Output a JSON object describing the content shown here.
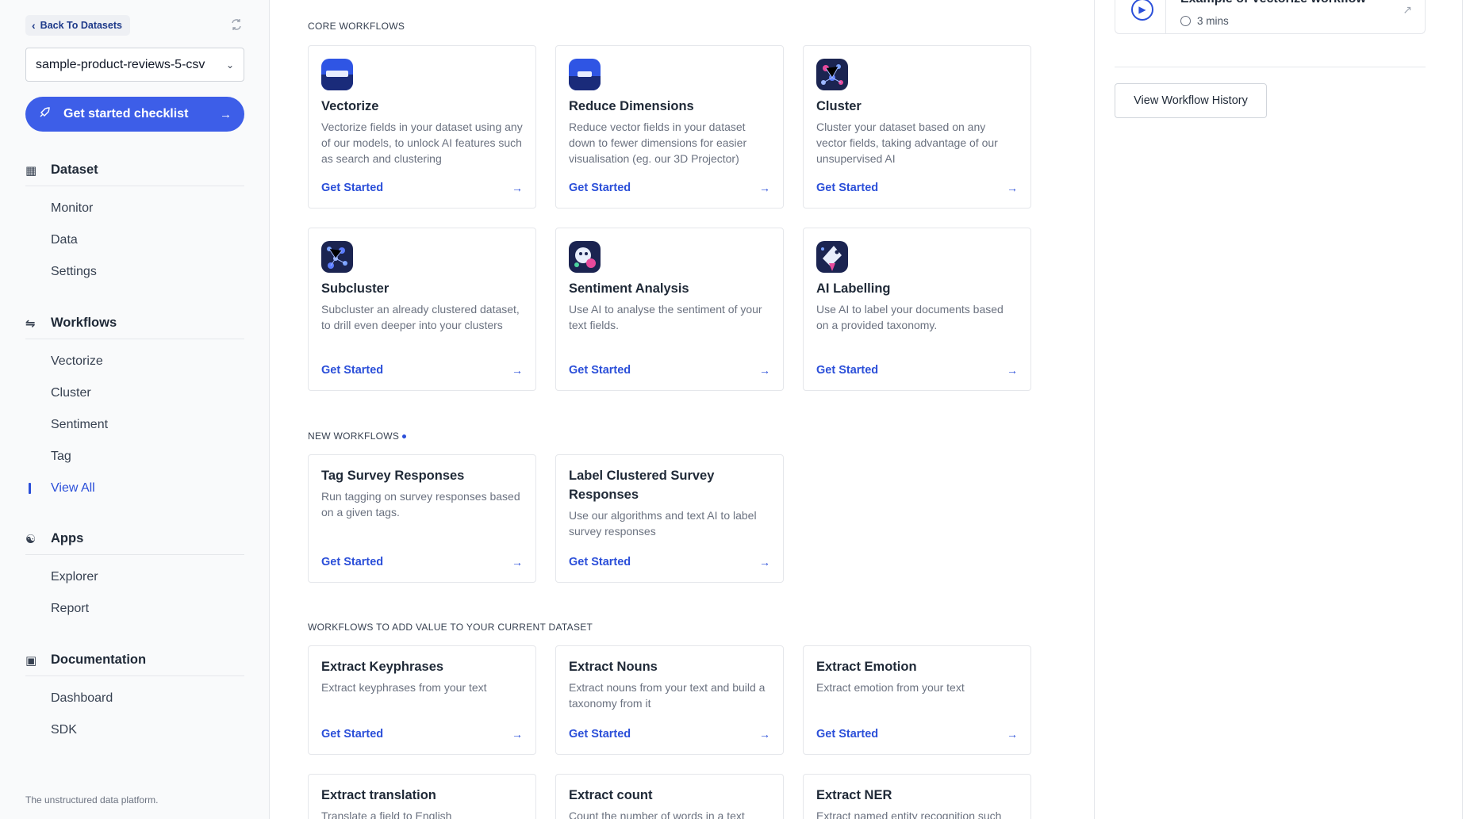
{
  "sidebar": {
    "back_label": "Back To Datasets",
    "dataset_name": "sample-product-reviews-5-csv",
    "checklist_label": "Get started checklist",
    "sections": [
      {
        "title": "Dataset",
        "icon": "table-icon",
        "items": [
          "Monitor",
          "Data",
          "Settings"
        ]
      },
      {
        "title": "Workflows",
        "icon": "workflow-icon",
        "items": [
          "Vectorize",
          "Cluster",
          "Sentiment",
          "Tag",
          "View All"
        ]
      },
      {
        "title": "Apps",
        "icon": "apps-icon",
        "items": [
          "Explorer",
          "Report"
        ]
      },
      {
        "title": "Documentation",
        "icon": "docs-icon",
        "items": [
          "Dashboard",
          "SDK"
        ]
      }
    ],
    "active_item": "View All",
    "tagline": "The unstructured data platform."
  },
  "main": {
    "core_title": "Core Workflows",
    "new_title": "New Workflows",
    "value_title": "Workflows to add value to your current dataset",
    "cta_label": "Get Started",
    "core": [
      {
        "title": "Vectorize",
        "desc": "Vectorize fields in your dataset using any of our models, to unlock AI features such as search and clustering",
        "icon": "vectorize-icon"
      },
      {
        "title": "Reduce Dimensions",
        "desc": "Reduce vector fields in your dataset down to fewer dimensions for easier visualisation (eg. our 3D Projector)",
        "icon": "reduce-dimensions-icon"
      },
      {
        "title": "Cluster",
        "desc": "Cluster your dataset based on any vector fields, taking advantage of our unsupervised AI",
        "icon": "cluster-icon"
      },
      {
        "title": "Subcluster",
        "desc": "Subcluster an already clustered dataset, to drill even deeper into your clusters",
        "icon": "subcluster-icon"
      },
      {
        "title": "Sentiment Analysis",
        "desc": "Use AI to analyse the sentiment of your text fields.",
        "icon": "sentiment-icon"
      },
      {
        "title": "AI Labelling",
        "desc": "Use AI to label your documents based on a provided taxonomy.",
        "icon": "ai-labelling-icon"
      }
    ],
    "new": [
      {
        "title": "Tag Survey Responses",
        "desc": "Run tagging on survey responses based on a given tags."
      },
      {
        "title": "Label Clustered Survey Responses",
        "desc": "Use our algorithms and text AI to label survey responses"
      }
    ],
    "value": [
      {
        "title": "Extract Keyphrases",
        "desc": "Extract keyphrases from your text"
      },
      {
        "title": "Extract Nouns",
        "desc": "Extract nouns from your text and build a taxonomy from it"
      },
      {
        "title": "Extract Emotion",
        "desc": "Extract emotion from your text"
      },
      {
        "title": "Extract translation",
        "desc": "Translate a field to English"
      },
      {
        "title": "Extract count",
        "desc": "Count the number of words in a text"
      },
      {
        "title": "Extract NER",
        "desc": "Extract named entity recognition such"
      }
    ]
  },
  "right": {
    "video_title": "Example of Vectorize workflow",
    "video_duration": "3 mins",
    "history_label": "View Workflow History"
  },
  "colors": {
    "accent": "#2b4fd9",
    "button": "#3d5ee8"
  }
}
